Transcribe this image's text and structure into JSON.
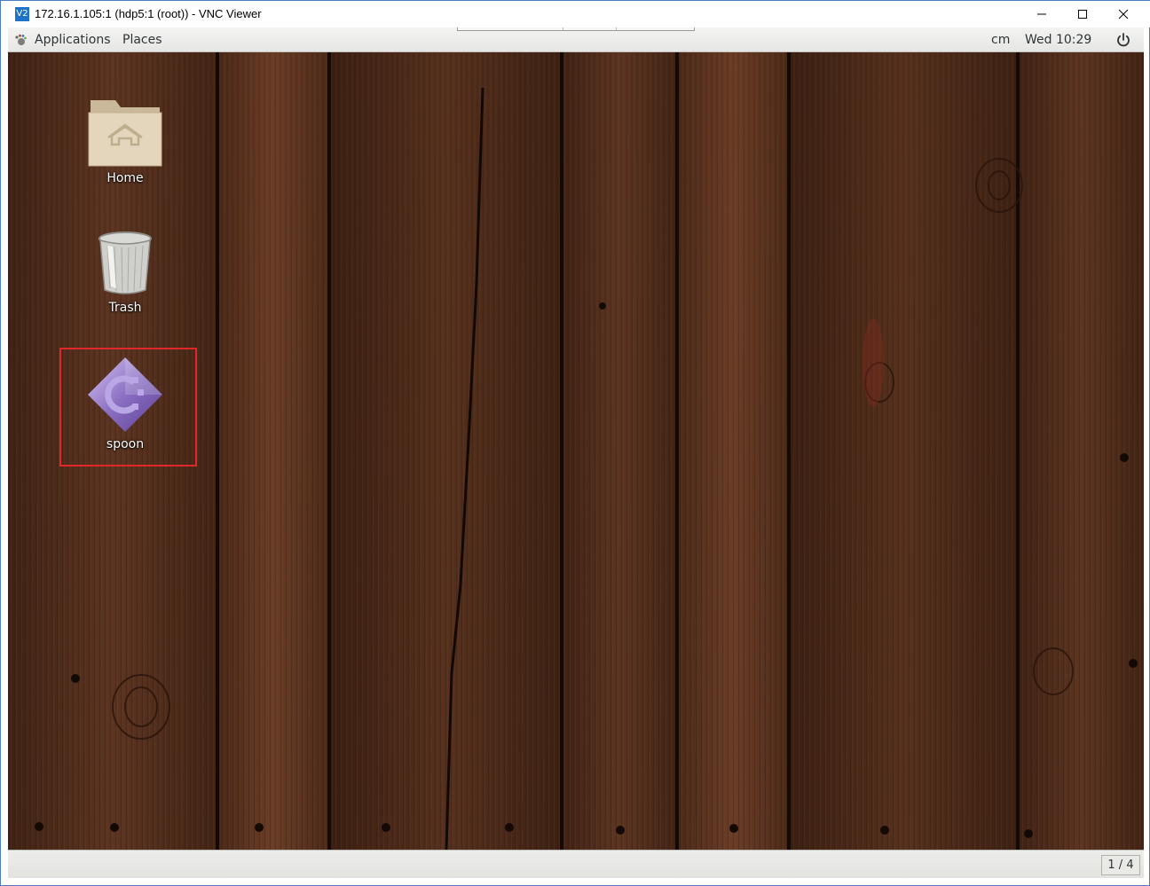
{
  "window": {
    "title": "172.16.1.105:1 (hdp5:1 (root)) - VNC Viewer",
    "app_icon_text": "V2",
    "minimize_icon": "minimize-icon",
    "maximize_icon": "maximize-icon",
    "close_icon": "close-icon"
  },
  "top_panel": {
    "applications_label": "Applications",
    "places_label": "Places",
    "user_label": "cm",
    "clock": "Wed 10:29",
    "power_icon": "power-icon"
  },
  "desktop": {
    "icons": [
      {
        "label": "Home",
        "icon": "home-folder-icon"
      },
      {
        "label": "Trash",
        "icon": "trash-icon"
      },
      {
        "label": "spoon",
        "icon": "spoon-app-icon"
      }
    ],
    "highlight_color": "#e0282a"
  },
  "bottom_panel": {
    "workspace": "1 / 4"
  },
  "colors": {
    "wood_dark": "#3b2012",
    "wood_mid": "#5a3220",
    "panel": "#ececea",
    "window_border": "#4a7dbf"
  }
}
